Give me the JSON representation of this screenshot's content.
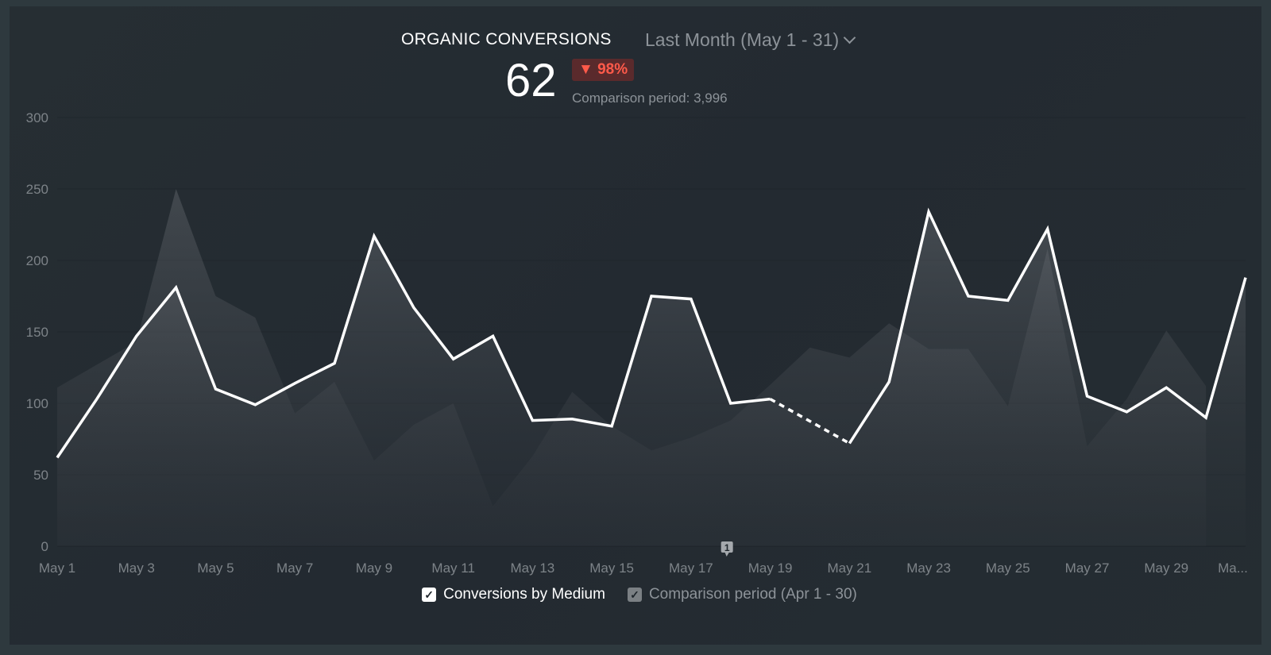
{
  "header": {
    "title": "ORGANIC CONVERSIONS",
    "period_label": "Last Month (May 1 - 31)",
    "value": "62",
    "change_badge": "▼ 98%",
    "comparison_text": "Comparison period: 3,996"
  },
  "colors": {
    "primary_line": "#ffffff",
    "comparison_area": "#5c6066",
    "badge_text": "#ff5a4a",
    "badge_bg": "#5a2a2c"
  },
  "annotation": {
    "label": "1",
    "at": "May 18"
  },
  "legend": [
    {
      "label": "Conversions by Medium",
      "checked": true
    },
    {
      "label": "Comparison period (Apr 1 - 30)",
      "checked": true
    }
  ],
  "chart_data": {
    "type": "line",
    "title": "ORGANIC CONVERSIONS",
    "xlabel": "",
    "ylabel": "",
    "ylim": [
      0,
      300
    ],
    "yticks": [
      0,
      50,
      100,
      150,
      200,
      250,
      300
    ],
    "grid": true,
    "legend_position": "bottom",
    "x": [
      "May 1",
      "May 2",
      "May 3",
      "May 4",
      "May 5",
      "May 6",
      "May 7",
      "May 8",
      "May 9",
      "May 10",
      "May 11",
      "May 12",
      "May 13",
      "May 14",
      "May 15",
      "May 16",
      "May 17",
      "May 18",
      "May 19",
      "May 20",
      "May 21",
      "May 22",
      "May 23",
      "May 24",
      "May 25",
      "May 26",
      "May 27",
      "May 28",
      "May 29",
      "May 30",
      "May 31"
    ],
    "xtick_labels": [
      "May 1",
      "May 3",
      "May 5",
      "May 7",
      "May 9",
      "May 11",
      "May 13",
      "May 15",
      "May 17",
      "May 19",
      "May 21",
      "May 23",
      "May 25",
      "May 27",
      "May 29",
      "Ma..."
    ],
    "series": [
      {
        "name": "Conversions by Medium",
        "style": "line",
        "values": [
          62,
          103,
          147,
          181,
          110,
          99,
          114,
          128,
          217,
          167,
          131,
          147,
          88,
          89,
          84,
          175,
          173,
          100,
          103,
          null,
          72,
          115,
          234,
          175,
          172,
          222,
          105,
          94,
          111,
          90,
          188
        ],
        "gap_dashed": [
          "May 19",
          "May 21"
        ]
      },
      {
        "name": "Comparison period (Apr 1 - 30)",
        "style": "area",
        "values": [
          111,
          127,
          143,
          250,
          175,
          160,
          93,
          115,
          60,
          85,
          100,
          28,
          63,
          108,
          84,
          67,
          76,
          88,
          113,
          139,
          132,
          156,
          138,
          138,
          98,
          208,
          70,
          103,
          151,
          112
        ]
      }
    ]
  }
}
